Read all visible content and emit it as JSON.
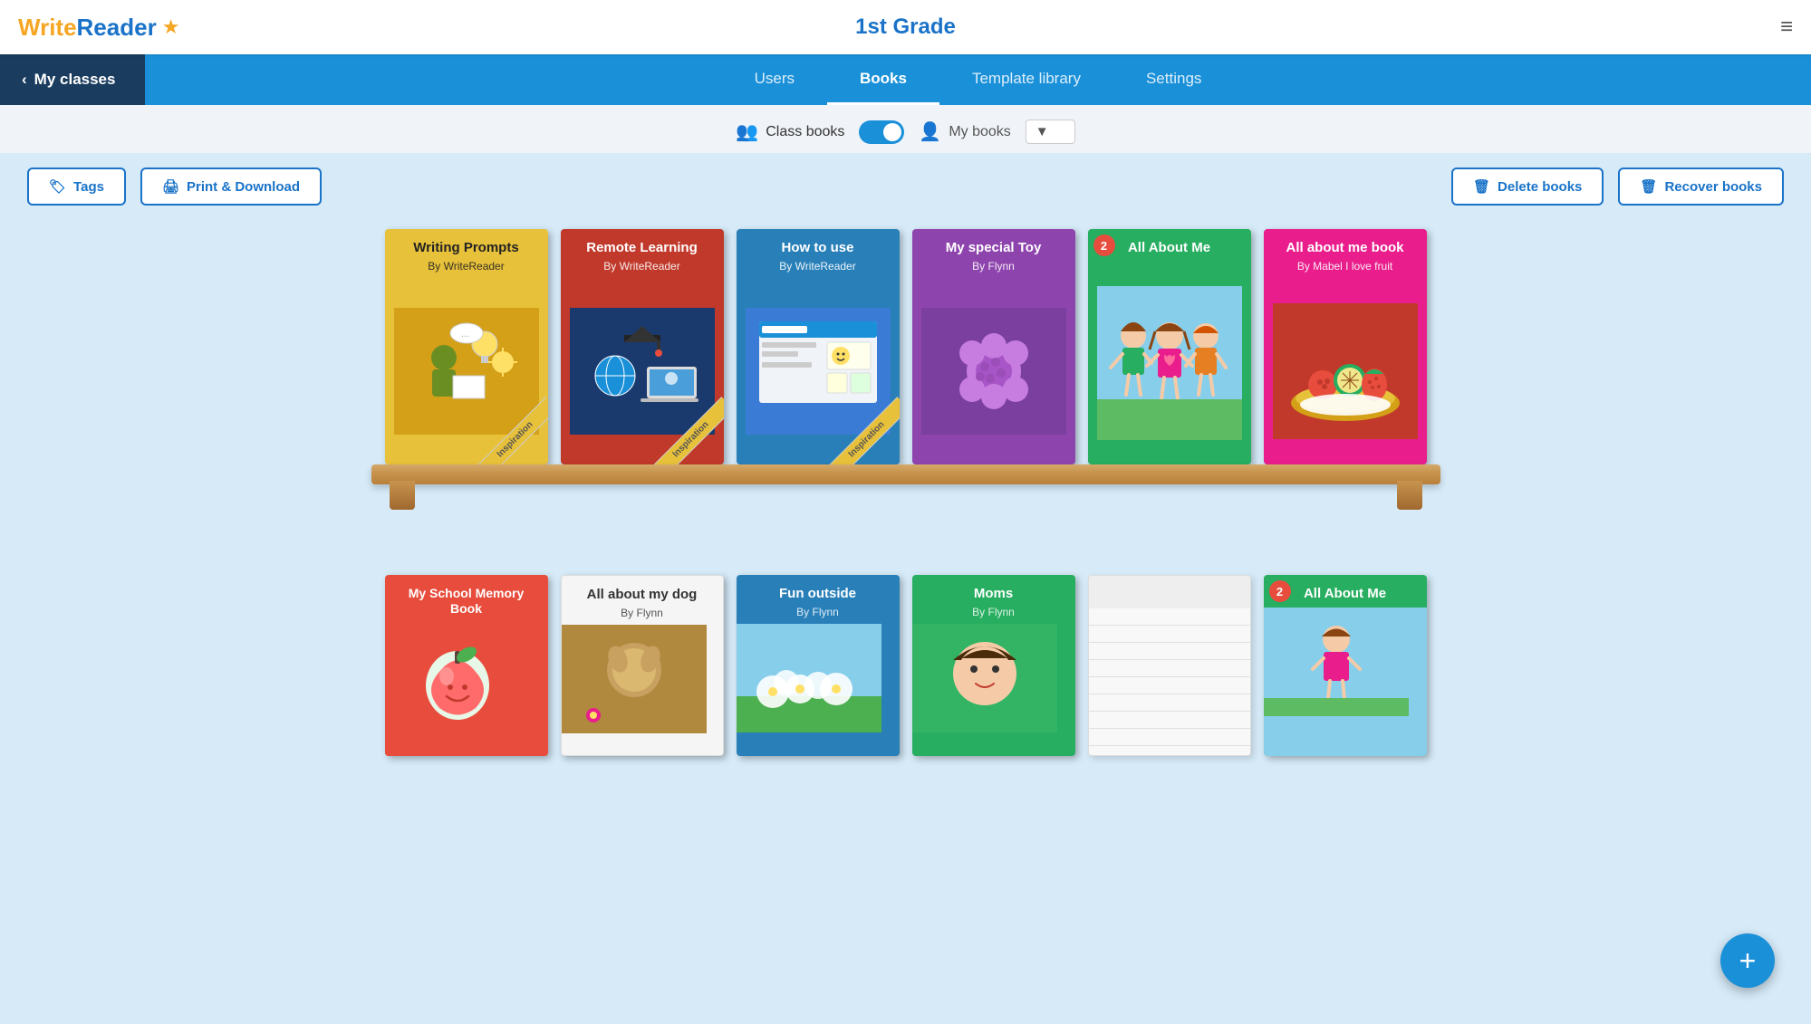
{
  "header": {
    "logo_write": "Write",
    "logo_reader": "Reader",
    "title": "1st Grade"
  },
  "nav": {
    "myclasses_label": "My classes",
    "tabs": [
      {
        "id": "users",
        "label": "Users",
        "active": false
      },
      {
        "id": "books",
        "label": "Books",
        "active": true
      },
      {
        "id": "template_library",
        "label": "Template library",
        "active": false
      },
      {
        "id": "settings",
        "label": "Settings",
        "active": false
      }
    ]
  },
  "toggle": {
    "class_books_label": "Class books",
    "my_books_label": "My books"
  },
  "actions": {
    "tags_label": "Tags",
    "print_download_label": "Print & Download",
    "delete_books_label": "Delete books",
    "recover_books_label": "Recover books"
  },
  "shelf1": {
    "books": [
      {
        "id": "writing-prompts",
        "title": "Writing Prompts",
        "author": "By WriteReader",
        "color": "yellow",
        "inspiration": true,
        "badge": 0
      },
      {
        "id": "remote-learning",
        "title": "Remote Learning",
        "author": "By WriteReader",
        "color": "red",
        "inspiration": true,
        "badge": 0
      },
      {
        "id": "how-to-use",
        "title": "How to use",
        "author": "By WriteReader",
        "color": "blue",
        "inspiration": true,
        "badge": 0
      },
      {
        "id": "my-special-toy",
        "title": "My special Toy",
        "author": "By Flynn",
        "color": "purple",
        "inspiration": false,
        "badge": 0
      },
      {
        "id": "all-about-me-1",
        "title": "All About Me",
        "author": "",
        "color": "green",
        "inspiration": false,
        "badge": 2
      },
      {
        "id": "all-about-me-book",
        "title": "All about me book",
        "author": "By Mabel I love fruit",
        "color": "pink",
        "inspiration": false,
        "badge": 0
      }
    ]
  },
  "shelf2": {
    "books": [
      {
        "id": "my-school-memory",
        "title": "My School Memory Book",
        "author": "",
        "color": "orange",
        "inspiration": false,
        "badge": 0
      },
      {
        "id": "all-about-my-dog",
        "title": "All about my dog",
        "author": "By Flynn",
        "color": "white",
        "inspiration": false,
        "badge": 0
      },
      {
        "id": "fun-outside",
        "title": "Fun outside",
        "author": "By Flynn",
        "color": "blue",
        "inspiration": false,
        "badge": 0
      },
      {
        "id": "moms",
        "title": "Moms",
        "author": "By Flynn",
        "color": "dkgreen",
        "inspiration": false,
        "badge": 0
      },
      {
        "id": "blank-book",
        "title": "",
        "author": "",
        "color": "white",
        "inspiration": false,
        "badge": 0
      },
      {
        "id": "all-about-me-2",
        "title": "All About Me",
        "author": "",
        "color": "green",
        "inspiration": false,
        "badge": 2
      }
    ]
  },
  "fab": {
    "label": "+"
  }
}
